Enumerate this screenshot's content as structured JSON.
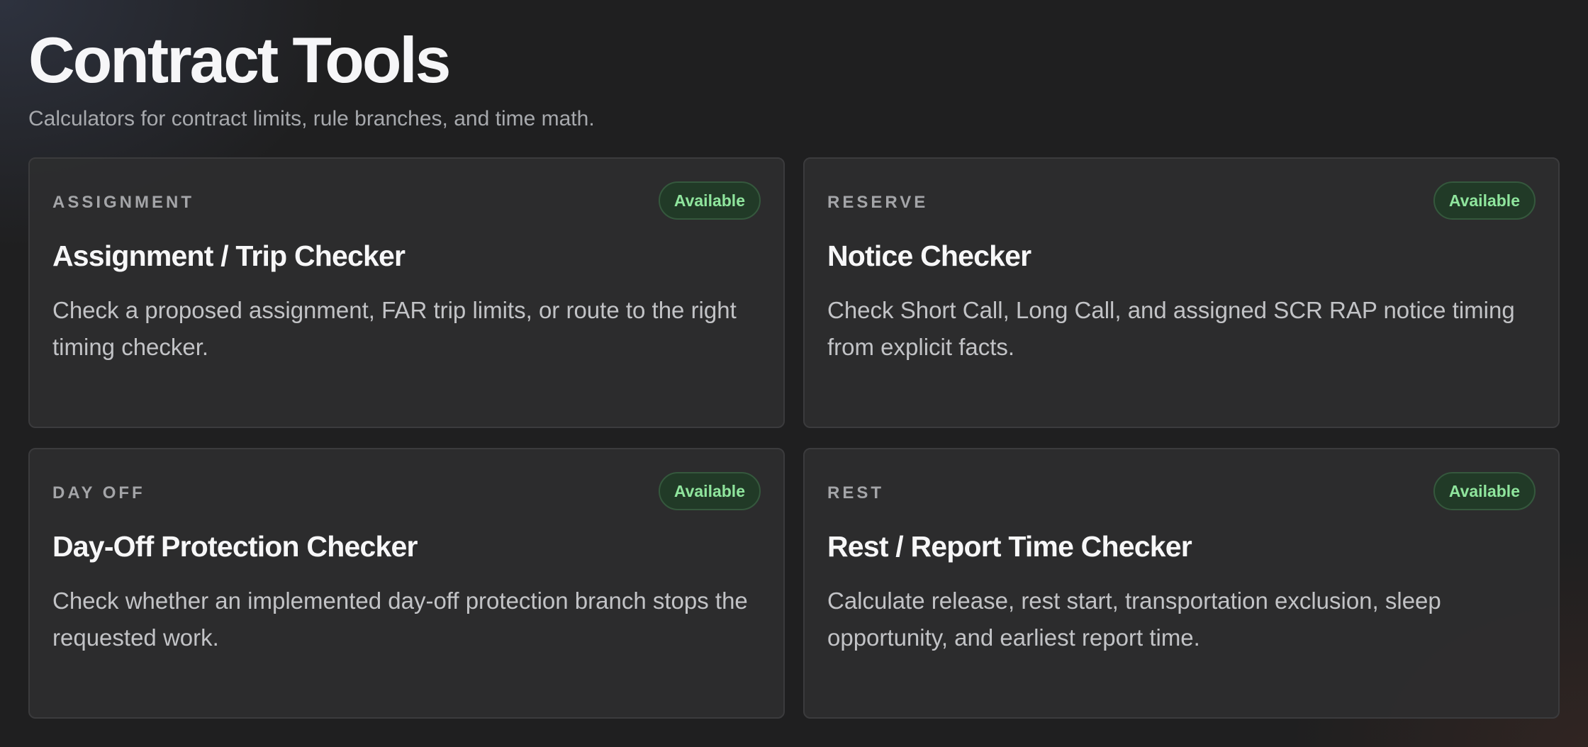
{
  "header": {
    "title": "Contract Tools",
    "subtitle": "Calculators for contract limits, rule branches, and time math."
  },
  "colors": {
    "background": "#1f1f20",
    "card": "#2e2e2f",
    "badge_text": "#8fe59d",
    "badge_bg": "#213a27"
  },
  "cards": [
    {
      "eyebrow": "ASSIGNMENT",
      "title": "Assignment / Trip Checker",
      "description": "Check a proposed assignment, FAR trip limits, or route to the right timing checker.",
      "status": "Available"
    },
    {
      "eyebrow": "RESERVE",
      "title": "Notice Checker",
      "description": "Check Short Call, Long Call, and assigned SCR RAP notice timing from explicit facts.",
      "status": "Available"
    },
    {
      "eyebrow": "DAY OFF",
      "title": "Day-Off Protection Checker",
      "description": "Check whether an implemented day-off protection branch stops the requested work.",
      "status": "Available"
    },
    {
      "eyebrow": "REST",
      "title": "Rest / Report Time Checker",
      "description": "Calculate release, rest start, transportation exclusion, sleep opportunity, and earliest report time.",
      "status": "Available"
    }
  ]
}
